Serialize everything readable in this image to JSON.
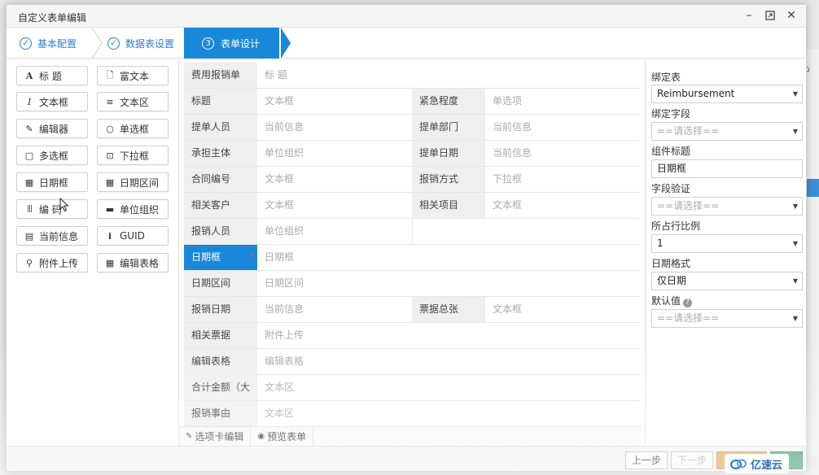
{
  "window": {
    "title": "自定义表单编辑",
    "controls": [
      "minimize-icon",
      "maximize-icon",
      "close-icon"
    ]
  },
  "steps": [
    {
      "label": "基本配置",
      "icon": "check-circle-icon",
      "state": "done"
    },
    {
      "label": "数据表设置",
      "icon": "check-circle-icon",
      "state": "done"
    },
    {
      "label": "表单设计",
      "number": "③",
      "state": "active"
    }
  ],
  "toolbox": [
    {
      "label": "标 题",
      "icon": "A"
    },
    {
      "label": "富文本",
      "icon": "🗋"
    },
    {
      "label": "文本框",
      "icon": "I"
    },
    {
      "label": "文本区",
      "icon": "≡"
    },
    {
      "label": "编辑器",
      "icon": "✎"
    },
    {
      "label": "单选框",
      "icon": "○"
    },
    {
      "label": "多选框",
      "icon": "□"
    },
    {
      "label": "下拉框",
      "icon": "⊡"
    },
    {
      "label": "日期框",
      "icon": "▦"
    },
    {
      "label": "日期区间",
      "icon": "▦"
    },
    {
      "label": "编 码",
      "icon": "|||"
    },
    {
      "label": "单位组织",
      "icon": "▬"
    },
    {
      "label": "当前信息",
      "icon": "▤"
    },
    {
      "label": "GUID",
      "icon": "i"
    },
    {
      "label": "附件上传",
      "icon": "⚲"
    },
    {
      "label": "编辑表格",
      "icon": "▦"
    }
  ],
  "form": {
    "title_row": {
      "label": "费用报销单",
      "placeholder": "标 题"
    },
    "rows": [
      {
        "l1": "标题",
        "p1": "文本框",
        "l2": "紧急程度",
        "p2": "单选项"
      },
      {
        "l1": "提单人员",
        "p1": "当前信息",
        "l2": "提单部门",
        "p2": "当前信息"
      },
      {
        "l1": "承担主体",
        "p1": "单位组织",
        "l2": "提单日期",
        "p2": "当前信息"
      },
      {
        "l1": "合同编号",
        "p1": "文本框",
        "l2": "报销方式",
        "p2": "下拉框"
      },
      {
        "l1": "相关客户",
        "p1": "文本框",
        "l2": "相关项目",
        "p2": "文本框"
      },
      {
        "l1": "报销人员",
        "p1": "单位组织",
        "l2": "",
        "p2": ""
      },
      {
        "l1": "日期框",
        "p1": "日期框",
        "selected": true
      },
      {
        "l1": "日期区间",
        "p1": "日期区间"
      },
      {
        "l1": "报销日期",
        "p1": "当前信息",
        "l2": "票据总张",
        "p2": "文本框"
      },
      {
        "l1": "相关票据",
        "p1": "附件上传"
      },
      {
        "l1": "编辑表格",
        "p1": "编辑表格"
      },
      {
        "l1": "合计金额（大",
        "p1": "文本区"
      },
      {
        "l1": "报销事由",
        "p1": "文本区"
      }
    ],
    "bottom_tabs": [
      {
        "label": "选项卡编辑",
        "icon": "edit-icon"
      },
      {
        "label": "预览表单",
        "icon": "eye-icon"
      }
    ]
  },
  "properties": {
    "bind_table_label": "绑定表",
    "bind_table_value": "Reimbursement",
    "bind_field_label": "绑定字段",
    "bind_field_value": "==请选择==",
    "component_title_label": "组件标题",
    "component_title_value": "日期框",
    "field_validation_label": "字段验证",
    "field_validation_value": "==请选择==",
    "row_ratio_label": "所占行比例",
    "row_ratio_value": "1",
    "date_format_label": "日期格式",
    "date_format_value": "仅日期",
    "default_value_label": "默认值",
    "default_value_value": "==请选择=="
  },
  "footer": {
    "prev": "上一步",
    "next": "下一步"
  },
  "watermark": {
    "text": "亿速云"
  },
  "colors": {
    "accent": "#1a88d9",
    "required": "#e05050"
  }
}
